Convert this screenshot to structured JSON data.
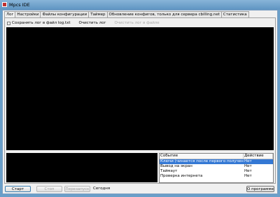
{
  "window": {
    "title": "Mpcs IDE"
  },
  "tabs": [
    {
      "label": "Лог"
    },
    {
      "label": "Настройки"
    },
    {
      "label": "Файлы конфигурации"
    },
    {
      "label": "Таймер"
    },
    {
      "label": "Обновление конфигов, только для сервера cbilling.net"
    },
    {
      "label": "Статистика"
    }
  ],
  "log_options": {
    "save_log_label": "Сохранять лог в файл log.txt",
    "clear_log_label": "Очистить лог",
    "clear_log_file_label": "Очистить лог в файле"
  },
  "events_table": {
    "headers": [
      "Событие",
      "Действие"
    ],
    "rows": [
      {
        "event": "Ключи (чинается после первого получения)",
        "action": "Нет"
      },
      {
        "event": "Вывод на экран",
        "action": "Нет"
      },
      {
        "event": "Таймаут",
        "action": "Нет"
      },
      {
        "event": "Проверка интернета",
        "action": "Нет"
      }
    ]
  },
  "bottom_bar": {
    "start_label": "Старт",
    "stop_label": "Стоп",
    "restart_label": "Перезапуск",
    "today_label": "Сегодня",
    "about_label": "О программе"
  },
  "colors": {
    "title_bar": "#6a9fc9",
    "log_background": "#000000",
    "selected_row": "#3478d4"
  }
}
